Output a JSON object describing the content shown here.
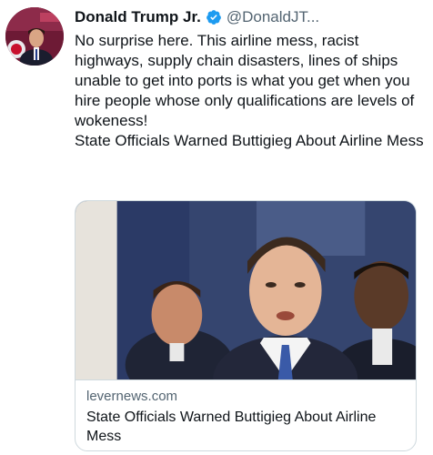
{
  "tweet": {
    "display_name": "Donald Trump Jr.",
    "handle": "@DonaldJT...",
    "body": "No surprise here. This airline mess, racist highways, supply chain disasters, lines of ships unable to get into ports is what you get when you hire people whose only qualifications are levels of wokeness!",
    "headline": "State Officials Warned Buttigieg About Airline Mess",
    "colors": {
      "verified_badge": "#1d9bf0",
      "secondary_text": "#536471"
    }
  },
  "card": {
    "domain": "levernews.com",
    "title": "State Officials Warned Buttigieg About Airline Mess"
  }
}
